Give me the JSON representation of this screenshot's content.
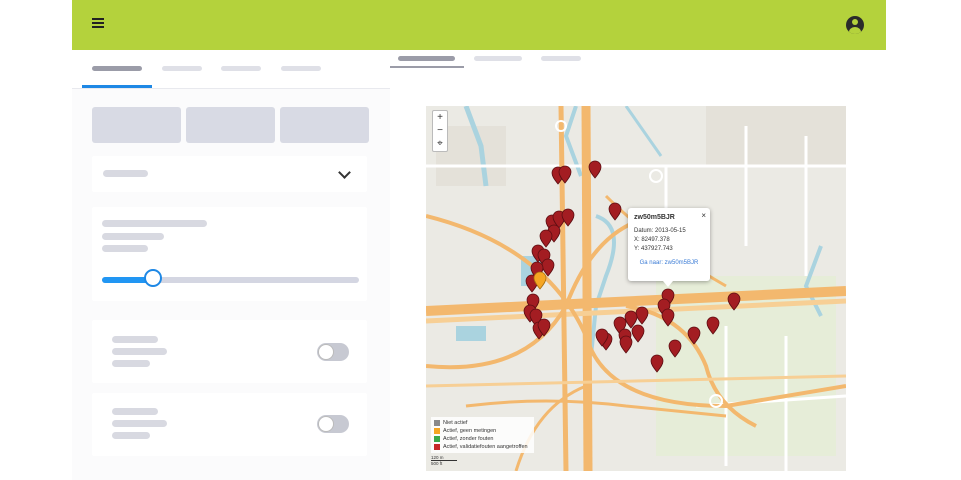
{
  "colors": {
    "accent_bar": "#b4d23c",
    "primary_blue": "#1e88e5",
    "marker_red": "#a31d22",
    "road_orange": "#f4c27c",
    "water": "#aad3df"
  },
  "icons": {
    "menu": "hamburger-menu-icon",
    "account": "account-circle-icon",
    "dropdown": "chevron-down-icon",
    "map_marker": "map-pin-icon",
    "close": "close-icon"
  },
  "map": {
    "zoom_in": "+",
    "zoom_out": "−",
    "popup": {
      "title": "zw50m5BJR",
      "date": "Datum: 2013-05-15",
      "x": "X: 82497.378",
      "y": "Y: 437927.743",
      "link": "Ga naar: zw50m5BJR",
      "close": "×"
    },
    "legend": [
      {
        "label": "Niet actief",
        "color": "#8a8a8a"
      },
      {
        "label": "Actief, geen metingen",
        "color": "#f5a623"
      },
      {
        "label": "Actief, zonder fouten",
        "color": "#3aa84a"
      },
      {
        "label": "Actief, validatiefouten aangetroffen",
        "color": "#c62828"
      }
    ],
    "scale_top": "120 m",
    "scale_bottom": "500 ft"
  }
}
